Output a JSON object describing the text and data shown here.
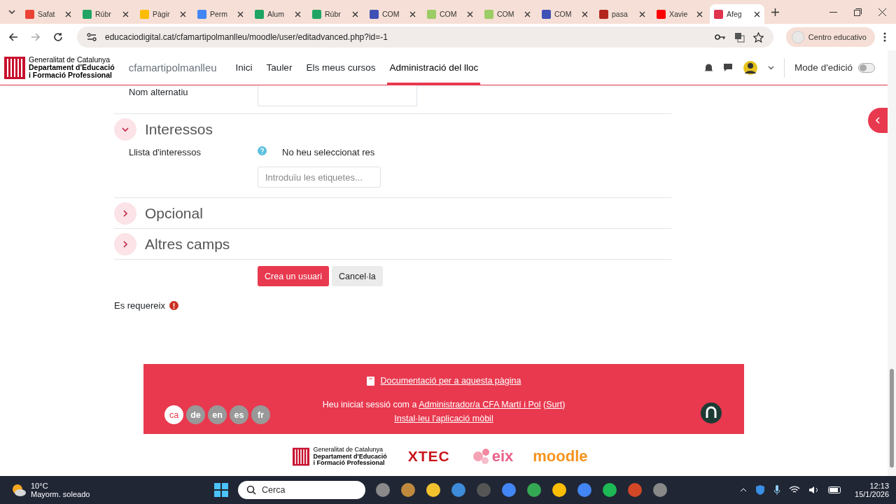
{
  "browser": {
    "tabs": [
      {
        "kind": "gmail",
        "label": "Safat",
        "selected": false
      },
      {
        "kind": "sheets",
        "label": "Rúbr",
        "selected": false
      },
      {
        "kind": "drive",
        "label": "Pàgir",
        "selected": false
      },
      {
        "kind": "docs",
        "label": "Perm",
        "selected": false
      },
      {
        "kind": "sheets",
        "label": "Alum",
        "selected": false
      },
      {
        "kind": "sheets",
        "label": "Rúbr",
        "selected": false
      },
      {
        "kind": "forms",
        "label": "COM",
        "selected": false
      },
      {
        "kind": "image",
        "label": "COM",
        "selected": false
      },
      {
        "kind": "image",
        "label": "COM",
        "selected": false
      },
      {
        "kind": "forms",
        "label": "COM",
        "selected": false
      },
      {
        "kind": "pdf",
        "label": "pasa",
        "selected": false
      },
      {
        "kind": "youtube",
        "label": "Xavie",
        "selected": false
      },
      {
        "kind": "edge",
        "label": "Afeg",
        "selected": true
      }
    ],
    "url": "educaciodigital.cat/cfamartipolmanlleu/moodle/user/editadvanced.php?id=-1",
    "profile": "Centro educativo"
  },
  "header": {
    "logo_lines": [
      "Generalitat de Catalunya",
      "Departament d'Educació",
      "i Formació Professional"
    ],
    "site": "cfamartipolmanlleu",
    "nav": [
      {
        "label": "Inici",
        "selected": false
      },
      {
        "label": "Tauler",
        "selected": false
      },
      {
        "label": "Els meus cursos",
        "selected": false
      },
      {
        "label": "Administració del lloc",
        "selected": true
      }
    ],
    "edit_mode": {
      "label": "Mode d'edició",
      "on": false
    }
  },
  "form": {
    "top_field": {
      "label": "Nom alternatiu"
    },
    "sections": [
      {
        "title": "Interessos",
        "expanded": true,
        "fields": [
          {
            "label": "Llista d'interessos",
            "value": "No heu seleccionat res",
            "placeholder": "Introduïu les etiquetes..."
          }
        ]
      },
      {
        "title": "Opcional",
        "expanded": false
      },
      {
        "title": "Altres camps",
        "expanded": false
      }
    ],
    "buttons": [
      {
        "label": "Crea un usuari",
        "kind": "primary"
      },
      {
        "label": "Cancel·la",
        "kind": "secondary"
      }
    ],
    "required_note": "Es requereix"
  },
  "footer": {
    "doc_link": "Documentació per a aquesta pàgina",
    "login_prefix": "Heu iniciat sessió com a ",
    "login_user": "Administrador/a CFA Martí i Pol",
    "login_open": " (",
    "logout": "Surt",
    "login_close": ")",
    "app_link": "Instal·leu l'aplicació mòbil",
    "languages": [
      {
        "code": "ca",
        "selected": true
      },
      {
        "code": "de",
        "selected": false
      },
      {
        "code": "en",
        "selected": false
      },
      {
        "code": "es",
        "selected": false
      },
      {
        "code": "fr",
        "selected": false
      }
    ],
    "logos": {
      "gencat": [
        "Generalitat de Catalunya",
        "Departament d'Educació",
        "i Formació Professional"
      ],
      "xtec": "XTEC",
      "eix": "eix",
      "moodle": "moodle"
    }
  },
  "taskbar": {
    "temperature": "10°C",
    "weather": "Mayorm. soleado",
    "search": "Cerca",
    "time": "12:13",
    "date": "15/1/2026"
  }
}
